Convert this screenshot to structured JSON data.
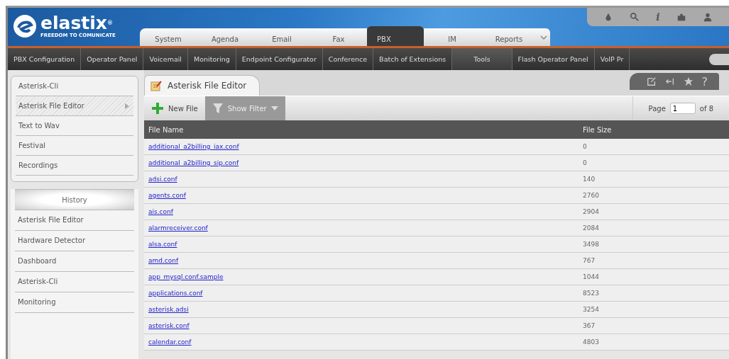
{
  "logo": {
    "name": "elastix",
    "mark": "®",
    "tagline": "FREEDOM TO COMUNICATE"
  },
  "tabs": [
    {
      "label": "System",
      "selected": false
    },
    {
      "label": "Agenda",
      "selected": false
    },
    {
      "label": "Email",
      "selected": false
    },
    {
      "label": "Fax",
      "selected": false
    },
    {
      "label": "PBX",
      "selected": true
    },
    {
      "label": "IM",
      "selected": false
    },
    {
      "label": "Reports",
      "selected": false
    }
  ],
  "top_info": "i",
  "nav": [
    {
      "label": "PBX Configuration",
      "selected": false
    },
    {
      "label": "Operator Panel",
      "selected": false
    },
    {
      "label": "Voicemail",
      "selected": false
    },
    {
      "label": "Monitoring",
      "selected": false
    },
    {
      "label": "Endpoint Configurator",
      "selected": false
    },
    {
      "label": "Conference",
      "selected": false
    },
    {
      "label": "Batch of Extensions",
      "selected": false
    },
    {
      "label": "Tools",
      "selected": true
    },
    {
      "label": "Flash Operator Panel",
      "selected": false
    },
    {
      "label": "VoIP Pr",
      "selected": false
    }
  ],
  "sidebar": {
    "items": [
      {
        "label": "Asterisk-Cli",
        "selected": false
      },
      {
        "label": "Asterisk File Editor",
        "selected": true
      },
      {
        "label": "Text to Wav",
        "selected": false
      },
      {
        "label": "Festival",
        "selected": false
      },
      {
        "label": "Recordings",
        "selected": false
      }
    ],
    "history_title": "History",
    "history": [
      "Asterisk File Editor",
      "Hardware Detector",
      "Dashboard",
      "Asterisk-Cli",
      "Monitoring"
    ]
  },
  "panel": {
    "title": "Asterisk File Editor",
    "help": "?",
    "toolbar": {
      "new_file": "New File",
      "show_filter": "Show Filter",
      "page_label": "Page",
      "page": "1",
      "of_pages": "of 8"
    },
    "table": {
      "columns": [
        "File Name",
        "File Size"
      ],
      "rows": [
        [
          "additional_a2billing_iax.conf",
          "0"
        ],
        [
          "additional_a2billing_sip.conf",
          "0"
        ],
        [
          "adsi.conf",
          "140"
        ],
        [
          "agents.conf",
          "2760"
        ],
        [
          "ais.conf",
          "2904"
        ],
        [
          "alarmreceiver.conf",
          "2084"
        ],
        [
          "alsa.conf",
          "3498"
        ],
        [
          "amd.conf",
          "767"
        ],
        [
          "app_mysql.conf.sample",
          "1044"
        ],
        [
          "applications.conf",
          "8523"
        ],
        [
          "asterisk.adsi",
          "3254"
        ],
        [
          "asterisk.conf",
          "367"
        ],
        [
          "calendar.conf",
          "4803"
        ]
      ]
    }
  }
}
